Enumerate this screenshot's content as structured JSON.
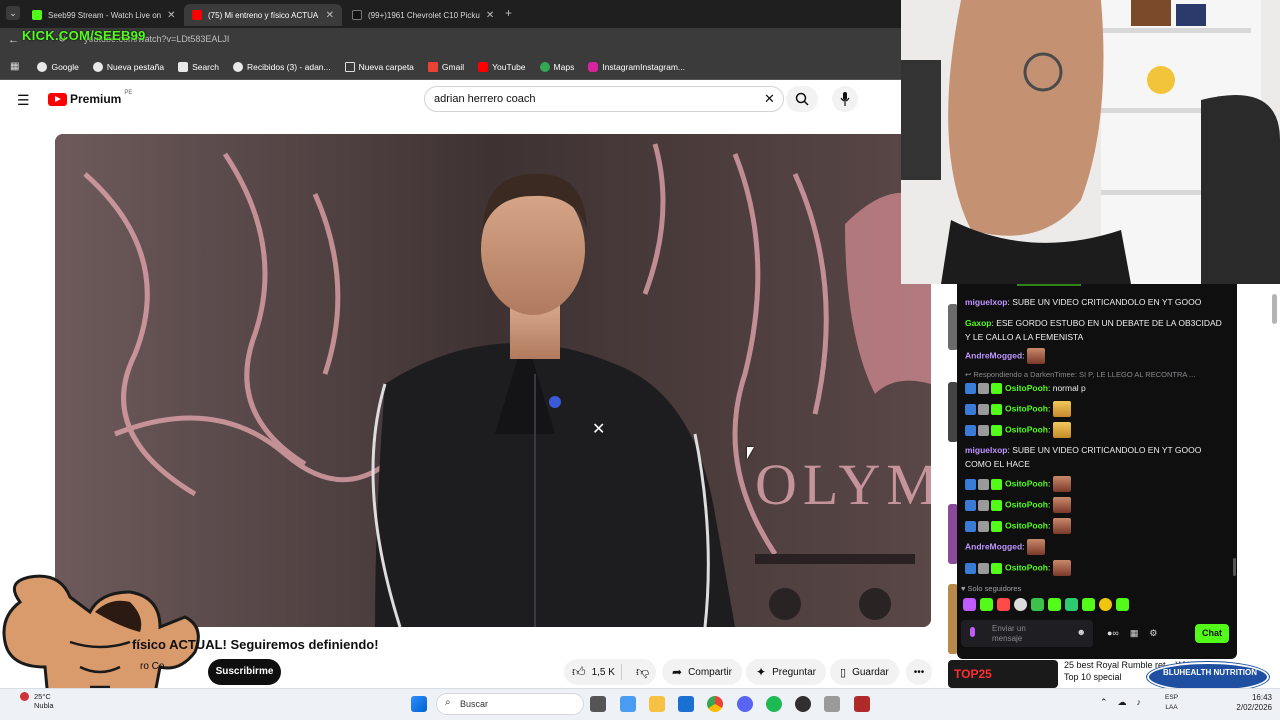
{
  "browser": {
    "tabs": [
      {
        "label": "Seeb99 Stream - Watch Live on",
        "active": false
      },
      {
        "label": "(75) Mi entreno y físico ACTUA",
        "active": true
      },
      {
        "label": "(99+)1961 Chevrolet C10 Picku",
        "active": false
      }
    ],
    "url": "youtube.com/watch?v=LDt583EALJI",
    "bookmarks": [
      "Google",
      "Nueva pestaña",
      "Search",
      "Recibidos (3) - adan...",
      "Nueva carpeta",
      "Gmail",
      "YouTube",
      "Maps",
      "InstagramInstagram..."
    ]
  },
  "overlay": {
    "kick_label": "KICK.COM/SEEB99",
    "sponsor_label": "BLUHEALTH NUTRITION"
  },
  "youtube": {
    "logo_text": "Premium",
    "region": "PE",
    "search_value": "adrian herrero coach",
    "video_wall_text": "OLYMPO",
    "video_title": "físico ACTUAL! Seguiremos definiendo!",
    "channel_partial": "ro Co",
    "subscribe_label": "Suscribirme",
    "like_count": "1,5 K",
    "share_label": "Compartir",
    "ask_label": "Preguntar",
    "save_label": "Guardar",
    "sidebar_rec_title": "25 best Royal Rumble ret... WWE Top 10 special",
    "sidebar_rec_badge": "TOP25"
  },
  "chat": {
    "messages": [
      {
        "user": "miguelxop",
        "color": "#bf94ff",
        "text": "SUBE UN VIDEO CRITICANDOLO EN YT GOOO",
        "badges": false,
        "emote": ""
      },
      {
        "user": "Gaxop",
        "color": "#53fc18",
        "text": "ESE GORDO ESTUBO EN UN DEBATE DE LA OB3CIDAD Y LE CALLO A LA FEMENISTA",
        "badges": false,
        "emote": ""
      },
      {
        "user": "AndreMogged",
        "color": "#bf94ff",
        "text": "",
        "badges": false,
        "emote": "face"
      },
      {
        "user": "OsitoPooh",
        "color": "#53fc18",
        "text": "normal p",
        "badges": true,
        "emote": "",
        "reply": "Respondiendo a DarkenTimee: SI P, LE LLEGO AL RECONTRA ..."
      },
      {
        "user": "OsitoPooh",
        "color": "#53fc18",
        "text": "",
        "badges": true,
        "emote": "gold"
      },
      {
        "user": "OsitoPooh",
        "color": "#53fc18",
        "text": "",
        "badges": true,
        "emote": "gold"
      },
      {
        "user": "miguelxop",
        "color": "#bf94ff",
        "text": "SUBE UN VIDEO CRITICANDOLO EN YT GOOO COMO EL HACE",
        "badges": false,
        "emote": ""
      },
      {
        "user": "OsitoPooh",
        "color": "#53fc18",
        "text": "",
        "badges": true,
        "emote": "face"
      },
      {
        "user": "OsitoPooh",
        "color": "#53fc18",
        "text": "",
        "badges": true,
        "emote": "face"
      },
      {
        "user": "OsitoPooh",
        "color": "#53fc18",
        "text": "",
        "badges": true,
        "emote": "face"
      },
      {
        "user": "AndreMogged",
        "color": "#bf94ff",
        "text": "",
        "badges": false,
        "emote": "face"
      },
      {
        "user": "OsitoPooh",
        "color": "#53fc18",
        "text": "",
        "badges": true,
        "emote": "face"
      }
    ],
    "followers_only": "Solo seguidores",
    "input_placeholder": "Enviar un mensaje",
    "chat_button": "Chat"
  },
  "taskbar": {
    "weather_temp": "25°C",
    "weather_desc": "Nubla",
    "search_placeholder": "Buscar",
    "lang": "ESP",
    "lang2": "LAA",
    "time": "16:43",
    "date": "2/02/2026"
  },
  "colors": {
    "kick_green": "#53fc18",
    "youtube_red": "#ff0000",
    "chat_bg": "#0f0f10"
  }
}
